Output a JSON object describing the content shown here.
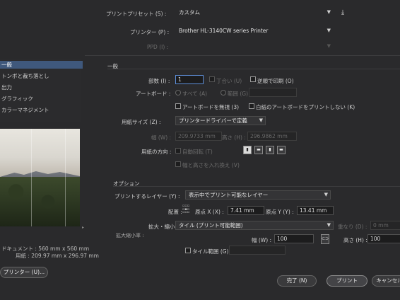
{
  "header": {
    "preset_label": "プリントプリセット (S) :",
    "preset_value": "カスタム",
    "printer_label": "プリンター (P) :",
    "printer_value": "Brother HL-3140CW series Printer",
    "ppd_label": "PPD (I) :"
  },
  "sidebar": {
    "items": [
      "一般",
      "トンボと裁ち落とし",
      "出力",
      "グラフィック",
      "カラーマネジメント"
    ]
  },
  "general": {
    "section_title": "一般",
    "copies_label": "部数 (I) :",
    "copies_value": "1",
    "collate_label": "丁合い (U)",
    "reverse_label": "逆順で印刷 (O)",
    "artboard_label": "アートボード :",
    "all_label": "すべて (A)",
    "range_label": "範囲 (G) :",
    "ignore_artboards_label": "アートボードを無視 (3)",
    "skip_blank_label": "白紙のアートボードをプリントしない (K)",
    "media_size_label": "用紙サイズ (Z) :",
    "media_size_value": "プリンタードライバーで定義",
    "width_label": "幅 (W) :",
    "width_value": "209.9733 mm",
    "height_label": "高さ (H) :",
    "height_value": "296.9862 mm",
    "orientation_label": "用紙の方向 :",
    "auto_rotate_label": "自動回転 (T)",
    "transverse_label": "幅と高さを入れ換え (V)"
  },
  "options": {
    "section_title": "オプション",
    "layers_label": "プリントするレイヤー (Y) :",
    "layers_value": "表示中でプリント可能なレイヤー",
    "placement_label": "配置 :",
    "origin_x_label": "原点 X (X) :",
    "origin_x_value": "7.41 mm",
    "origin_y_label": "原点 Y (Y) :",
    "origin_y_value": "13.41 mm",
    "scale_label": "拡大・縮小 :",
    "scale_value": "タイル (プリント可能範囲)",
    "overlap_label": "重なり (D) :",
    "overlap_value": "0 mm",
    "ratio_label": "拡大縮小率 :",
    "scale_w_label": "幅 (W) :",
    "scale_w_value": "100",
    "scale_h_label": "高さ (H) :",
    "scale_h_value": "100",
    "tile_range_label": "タイル範囲 (G) :"
  },
  "preview": {
    "document_label": "ドキュメント : 560 mm x 560 mm",
    "media_label": "用紙 : 209.97 mm x 296.97 mm"
  },
  "footer": {
    "printer_button": "プリンター (U)...",
    "done_button": "完了 (N)",
    "print_button": "プリント",
    "cancel_button": "キャンセル"
  }
}
